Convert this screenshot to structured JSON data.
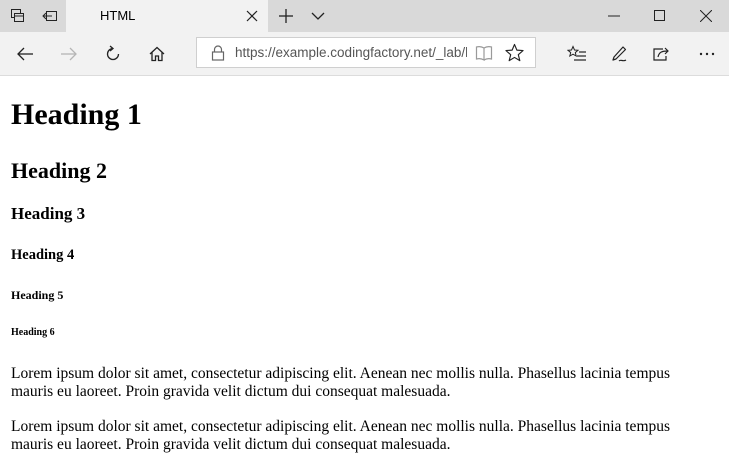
{
  "browser": {
    "tab": {
      "title": "HTML"
    },
    "address_bar": {
      "url": "https://example.codingfactory.net/_lab/h"
    },
    "icons": {
      "set_aside_tabs": "set-aside-tabs-icon",
      "tabs_aside": "tabs-aside-icon",
      "new_tab": "plus-icon",
      "tab_preview": "chevron-down-icon",
      "back": "arrow-left-icon",
      "forward": "arrow-right-icon",
      "refresh": "refresh-icon",
      "home": "home-icon",
      "lock": "lock-icon",
      "reading_view": "book-icon",
      "favorite": "star-icon",
      "favorites_hub": "favorites-list-icon",
      "notes": "pen-icon",
      "share": "share-icon",
      "more": "ellipsis-icon"
    }
  },
  "page": {
    "h1": "Heading 1",
    "h2": "Heading 2",
    "h3": "Heading 3",
    "h4": "Heading 4",
    "h5": "Heading 5",
    "h6": "Heading 6",
    "paragraphs": [
      "Lorem ipsum dolor sit amet, consectetur adipiscing elit. Aenean nec mollis nulla. Phasellus lacinia tempus mauris eu laoreet. Proin gravida velit dictum dui consequat malesuada.",
      "Lorem ipsum dolor sit amet, consectetur adipiscing elit. Aenean nec mollis nulla. Phasellus lacinia tempus mauris eu laoreet. Proin gravida velit dictum dui consequat malesuada."
    ]
  }
}
